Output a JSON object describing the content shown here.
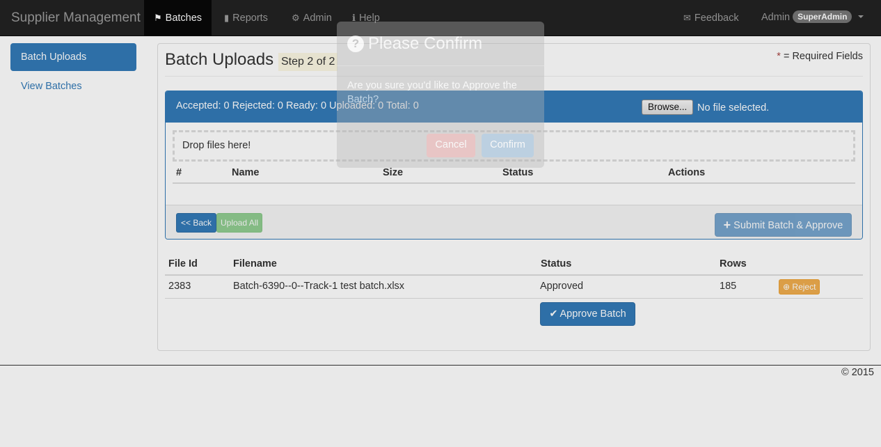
{
  "navbar": {
    "brand": "Supplier Management",
    "items": [
      {
        "label": "Batches",
        "icon": "flag-icon",
        "active": true
      },
      {
        "label": "Reports",
        "icon": "book-icon"
      },
      {
        "label": "Admin",
        "icon": "gear-icon"
      },
      {
        "label": "Help",
        "icon": "info-icon"
      }
    ],
    "feedback": "Feedback",
    "user": "Admin",
    "role": "SuperAdmin"
  },
  "sidebar": {
    "items": [
      {
        "label": "Batch Uploads",
        "active": true
      },
      {
        "label": "View Batches"
      }
    ]
  },
  "main": {
    "title": "Batch Uploads",
    "step": "Step 2 of 2",
    "required_star": "*",
    "required_note": "= Required Fields",
    "upload": {
      "counts": "Accepted: 0 Rejected: 0 Ready: 0 Uploaded: 0 Total: 0",
      "browse_label": "Browse...",
      "file_status": "No file selected.",
      "drop_text": "Drop files here!",
      "columns": [
        "#",
        "Name",
        "Size",
        "Status",
        "Actions"
      ],
      "back_label": "<< Back",
      "upload_all_label": "Upload All",
      "submit_label": "Submit Batch & Approve"
    },
    "results": {
      "columns": [
        "File Id",
        "Filename",
        "Status",
        "Rows"
      ],
      "rows": [
        {
          "file_id": "2383",
          "filename": "Batch-6390--0--Track-1 test batch.xlsx",
          "status": "Approved",
          "rows": "185",
          "action": "Reject"
        }
      ],
      "approve_label": "Approve Batch"
    }
  },
  "footer": {
    "copyright": "© 2015"
  },
  "modal": {
    "title": "Please Confirm",
    "body": "Are you sure you'd like to Approve the Batch?",
    "cancel_label": "Cancel",
    "confirm_label": "Confirm"
  },
  "colors": {
    "primary": "#337ab7",
    "success": "#5cb85c",
    "warning": "#f0ad4e",
    "navbar": "#222222",
    "highlight": "#fcf8e3"
  }
}
